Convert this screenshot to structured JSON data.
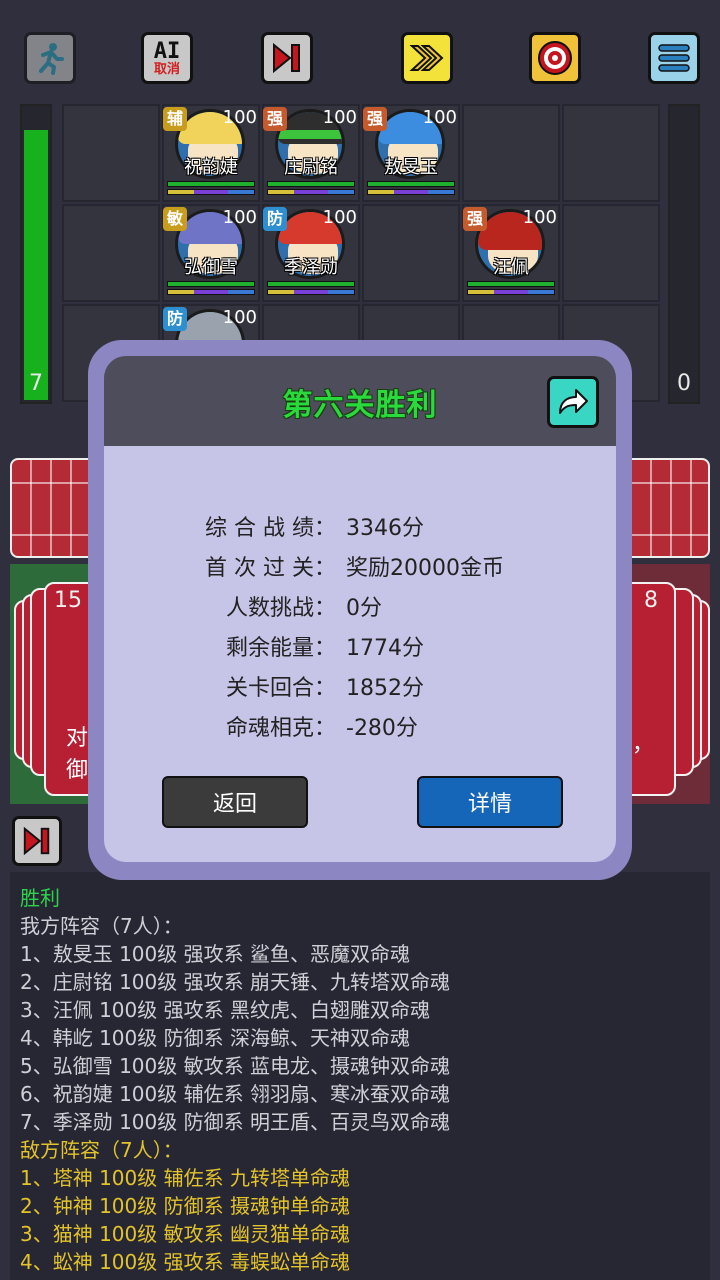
{
  "toolbar": {
    "ai_top": "AI",
    "ai_bottom": "取消"
  },
  "energy": {
    "left_value": "7",
    "right_value": "0",
    "left_fill_fraction": 0.9,
    "right_fill_fraction": 0
  },
  "heroes": [
    {
      "tag": "辅",
      "tag_type": "p",
      "level": "100",
      "name": "祝韵婕",
      "hair": "#f1d35c"
    },
    {
      "tag": "强",
      "tag_type": "q",
      "level": "100",
      "name": "庄尉铭",
      "hair": "#2e2e2e"
    },
    {
      "tag": "强",
      "tag_type": "q",
      "level": "100",
      "name": "敖旻玉",
      "hair": "#3c8de0"
    },
    {
      "tag": "敏",
      "tag_type": "m",
      "level": "100",
      "name": "弘御雪",
      "hair": "#6f74c7"
    },
    {
      "tag": "防",
      "tag_type": "f",
      "level": "100",
      "name": "季泽勋",
      "hair": "#d63a2c"
    },
    {
      "tag": "强",
      "tag_type": "q",
      "level": "100",
      "name": "汪佩",
      "hair": "#b8261e"
    },
    {
      "tag": "防",
      "tag_type": "f",
      "level": "100",
      "name": "",
      "hair": "#9aa3ad"
    }
  ],
  "decks": {
    "left_count": "15",
    "right_count": "8",
    "left_text_1": "对",
    "left_text_2": "御",
    "right_text": "，"
  },
  "modal": {
    "title": "第六关胜利",
    "rows": [
      {
        "label": "综 合 战 绩：",
        "value": "3346分"
      },
      {
        "label": "首 次 过 关：",
        "value": "奖励20000金币"
      },
      {
        "label": "人数挑战：",
        "value": "0分"
      },
      {
        "label": "剩余能量：",
        "value": "1774分"
      },
      {
        "label": "关卡回合：",
        "value": "1852分"
      },
      {
        "label": "命魂相克：",
        "value": "-280分"
      }
    ],
    "back_label": "返回",
    "detail_label": "详情"
  },
  "log": {
    "result": "胜利",
    "ally_header": "我方阵容（7人）：",
    "ally": [
      "1、敖旻玉 100级 强攻系 鲨鱼、恶魔双命魂",
      "2、庄尉铭 100级 强攻系 崩天锤、九转塔双命魂",
      "3、汪佩 100级 强攻系 黑纹虎、白翅雕双命魂",
      "4、韩屹 100级 防御系 深海鲸、天神双命魂",
      "5、弘御雪 100级 敏攻系 蓝电龙、摄魂钟双命魂",
      "6、祝韵婕 100级 辅佐系 翎羽扇、寒冰蚕双命魂",
      "7、季泽勋 100级 防御系 明王盾、百灵鸟双命魂"
    ],
    "enemy_header": "敌方阵容（7人）：",
    "enemy": [
      "1、塔神 100级 辅佐系 九转塔单命魂",
      "2、钟神 100级 防御系 摄魂钟单命魂",
      "3、猫神 100级 敏攻系 幽灵猫单命魂",
      "4、蚣神 100级 强攻系 毒蜈蚣单命魂"
    ]
  }
}
